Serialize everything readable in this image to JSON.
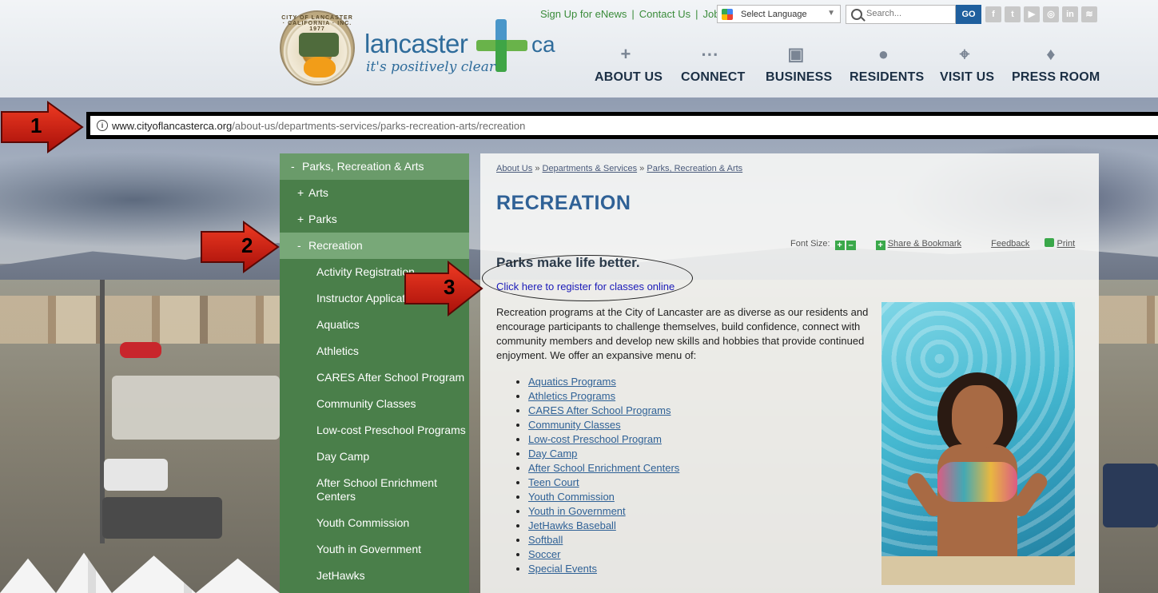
{
  "header": {
    "logo_word": "lancaster",
    "logo_ca": "ca",
    "logo_tagline": "it's positively clear",
    "seal_text": "CITY OF LANCASTER · CALIFORNIA · INC. 1977",
    "toplinks": [
      "Sign Up for eNews",
      "Contact Us",
      "Jobs"
    ],
    "language_label": "Select Language",
    "search_placeholder": "Search...",
    "go_label": "GO",
    "social": [
      {
        "icon": "facebook-icon",
        "glyph": "f"
      },
      {
        "icon": "twitter-icon",
        "glyph": "t"
      },
      {
        "icon": "youtube-icon",
        "glyph": "▶"
      },
      {
        "icon": "instagram-icon",
        "glyph": "◎"
      },
      {
        "icon": "linkedin-icon",
        "glyph": "in"
      },
      {
        "icon": "rss-icon",
        "glyph": "≋"
      }
    ],
    "nav": [
      {
        "label": "ABOUT US",
        "icon": "plus-icon",
        "glyph": "+"
      },
      {
        "label": "CONNECT",
        "icon": "share-icon",
        "glyph": "⋯"
      },
      {
        "label": "BUSINESS",
        "icon": "briefcase-icon",
        "glyph": "▣"
      },
      {
        "label": "RESIDENTS",
        "icon": "person-icon",
        "glyph": "●"
      },
      {
        "label": "VISIT US",
        "icon": "map-pin-icon",
        "glyph": "⌖"
      },
      {
        "label": "PRESS ROOM",
        "icon": "microphone-icon",
        "glyph": "♦"
      }
    ]
  },
  "urlbar": {
    "domain": "www.cityoflancasterca.org",
    "path": "/about-us/departments-services/parks-recreation-arts/recreation"
  },
  "annotations": [
    "1",
    "2",
    "3"
  ],
  "sidebar": {
    "top": {
      "toggle": "-",
      "label": "Parks, Recreation & Arts"
    },
    "items": [
      {
        "toggle": "+",
        "label": "Arts"
      },
      {
        "toggle": "+",
        "label": "Parks"
      },
      {
        "toggle": "-",
        "label": "Recreation"
      }
    ],
    "subitems": [
      "Activity Registration",
      "Instructor Applications",
      "Aquatics",
      "Athletics",
      "CARES After School Program",
      "Community Classes",
      "Low-cost Preschool Programs",
      "Day Camp",
      "After School Enrichment Centers",
      "Youth Commission",
      "Youth in Government",
      "JetHawks"
    ]
  },
  "content": {
    "breadcrumbs": [
      "About Us",
      "Departments & Services",
      "Parks, Recreation & Arts"
    ],
    "breadcrumb_sep": "»",
    "title": "RECREATION",
    "tools": {
      "font_size": "Font Size:",
      "plus": "+",
      "minus": "–",
      "share": "Share & Bookmark",
      "feedback": "Feedback",
      "print": "Print"
    },
    "heading": "Parks make life better.",
    "register_link": "Click here to register for classes online",
    "paragraph": "Recreation programs at the City of Lancaster are as diverse as our residents and encourage participants to challenge themselves, build confidence, connect with community members and develop new skills and hobbies that provide continued enjoyment. We offer an expansive menu of:",
    "programs": [
      "Aquatics Programs",
      "Athletics Programs",
      "CARES After School Programs",
      "Community Classes",
      "Low-cost Preschool Program",
      "Day Camp",
      "After School Enrichment Centers",
      "Teen Court",
      "Youth Commission",
      "Youth in Government",
      "JetHawks Baseball",
      "Softball",
      "Soccer",
      "Special Events"
    ]
  }
}
